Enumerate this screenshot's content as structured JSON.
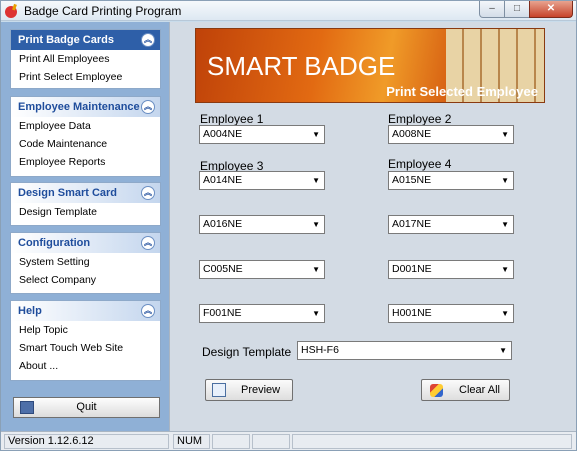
{
  "window": {
    "title": "Badge Card Printing Program",
    "minimize": "–",
    "maximize": "□",
    "close": "✕"
  },
  "sidebar": {
    "groups": [
      {
        "header": "Print Badge Cards",
        "items": [
          "Print All Employees",
          "Print Select Employee"
        ]
      },
      {
        "header": "Employee Maintenance",
        "items": [
          "Employee Data",
          "Code Maintenance",
          "Employee Reports"
        ]
      },
      {
        "header": "Design Smart Card",
        "items": [
          "Design Template"
        ]
      },
      {
        "header": "Configuration",
        "items": [
          "System Setting",
          "Select Company"
        ]
      },
      {
        "header": "Help",
        "items": [
          "Help Topic",
          "Smart Touch Web Site",
          "About ..."
        ]
      }
    ],
    "quit_label": "Quit"
  },
  "banner": {
    "title": "SMART BADGE",
    "subtitle": "Print Selected Employee"
  },
  "form": {
    "labels": {
      "e1": "Employee 1",
      "e2": "Employee 2",
      "e3": "Employee 3",
      "e4": "Employee 4"
    },
    "combos": [
      "A004NE",
      "A008NE",
      "A014NE",
      "A015NE",
      "A016NE",
      "A017NE",
      "C005NE",
      "D001NE",
      "F001NE",
      "H001NE"
    ],
    "template_label": "Design Template",
    "template_value": "HSH-F6",
    "preview_label": "Preview",
    "clear_label": "Clear All"
  },
  "status": {
    "version": "Version 1.12.6.12",
    "num": "NUM"
  },
  "colors": {
    "accent": "#2e5fa8",
    "sidebar_bg": "#8fb0d6",
    "main_bg": "#d3dbe4",
    "banner": "#e26a12"
  }
}
